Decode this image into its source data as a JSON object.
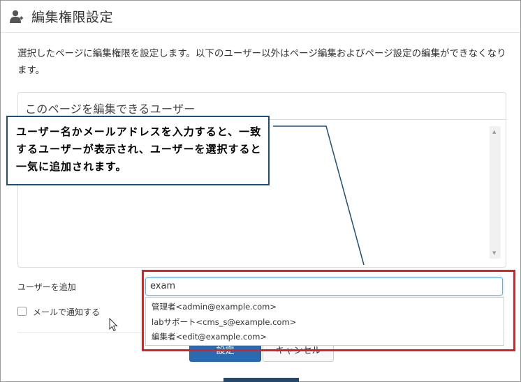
{
  "dialog": {
    "title": "編集権限設定",
    "description": "選択したページに編集権限を設定します。以下のユーザー以外はページ編集およびページ設定の編集ができなくなります。"
  },
  "editors_panel": {
    "title": "このページを編集できるユーザー",
    "scroll_up": "▲",
    "scroll_down": "▼"
  },
  "add_user": {
    "label": "ユーザーを追加",
    "value": "exam",
    "suggestions": [
      "管理者<admin@example.com>",
      "labサポート<cms_s@example.com>",
      "編集者<edit@example.com>"
    ]
  },
  "notify": {
    "label": "メールで通知する",
    "checked": false
  },
  "buttons": {
    "ok": "設定",
    "cancel": "キャンセル"
  },
  "callout": {
    "text": "ユーザー名かメールアドレスを入力すると、一致するユーザーが表示され、ユーザーを選択すると一気に追加されます。"
  },
  "colors": {
    "primary": "#2a6ab0",
    "callout_border": "#1f4e79",
    "highlight": "#e02020"
  },
  "icons": {
    "header": "user-add-icon",
    "cursor": "mouse-pointer-icon"
  }
}
